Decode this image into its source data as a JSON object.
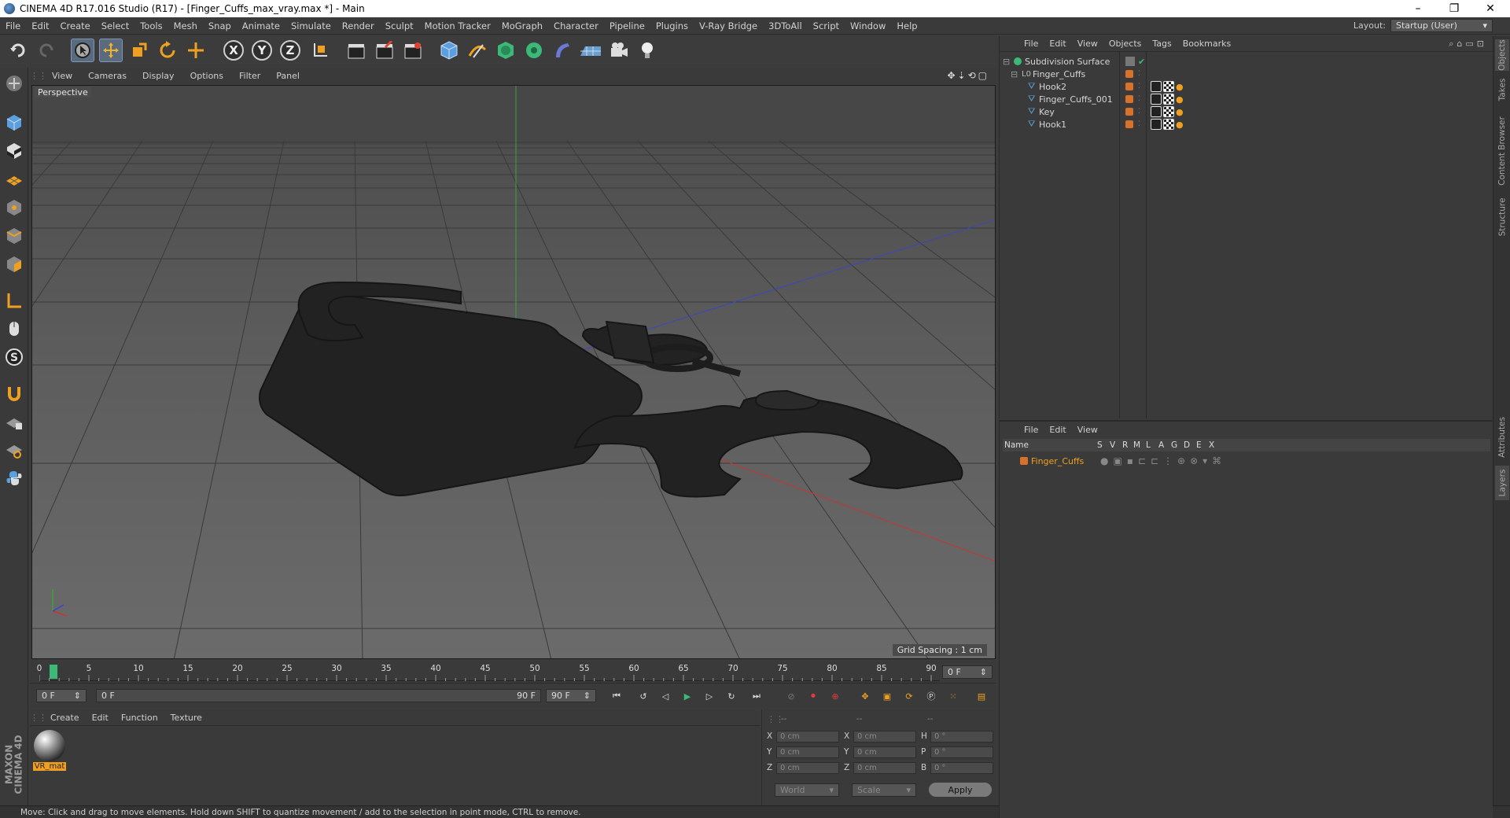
{
  "window": {
    "title": "CINEMA 4D R17.016 Studio (R17) - [Finger_Cuffs_max_vray.max *] - Main",
    "minimize": "–",
    "restore": "❐",
    "close": "✕"
  },
  "menu": [
    "File",
    "Edit",
    "Create",
    "Select",
    "Tools",
    "Mesh",
    "Snap",
    "Animate",
    "Simulate",
    "Render",
    "Sculpt",
    "Motion Tracker",
    "MoGraph",
    "Character",
    "Pipeline",
    "Plugins",
    "V-Ray Bridge",
    "3DToAll",
    "Script",
    "Window",
    "Help"
  ],
  "layout": {
    "label": "Layout:",
    "value": "Startup (User)"
  },
  "toolbar": {
    "axis_x": "X",
    "axis_y": "Y",
    "axis_z": "Z"
  },
  "viewport": {
    "menu": [
      "View",
      "Cameras",
      "Display",
      "Options",
      "Filter",
      "Panel"
    ],
    "label": "Perspective",
    "grid_spacing": "Grid Spacing : 1 cm"
  },
  "timeline": {
    "ticks": [
      "0",
      "5",
      "10",
      "15",
      "20",
      "25",
      "30",
      "35",
      "40",
      "45",
      "50",
      "55",
      "60",
      "65",
      "70",
      "75",
      "80",
      "85",
      "90"
    ],
    "current_frame": "0 F",
    "start": "0 F",
    "range_start": "0 F",
    "range_end": "90 F",
    "end": "90 F"
  },
  "material_manager": {
    "menu": [
      "Create",
      "Edit",
      "Function",
      "Texture"
    ],
    "material_name": "VR_mat"
  },
  "coordinates": {
    "header": [
      "--",
      "--",
      "--"
    ],
    "pos_labels": [
      "X",
      "Y",
      "Z"
    ],
    "pos_values": [
      "0 cm",
      "0 cm",
      "0 cm"
    ],
    "size_labels": [
      "X",
      "Y",
      "Z"
    ],
    "size_values": [
      "0 cm",
      "0 cm",
      "0 cm"
    ],
    "rot_labels": [
      "H",
      "P",
      "B"
    ],
    "rot_values": [
      "0 °",
      "0 °",
      "0 °"
    ],
    "mode": "World",
    "scale": "Scale",
    "apply": "Apply"
  },
  "objects": {
    "menu": [
      "File",
      "Edit",
      "View",
      "Objects",
      "Tags",
      "Bookmarks"
    ],
    "items": [
      {
        "name": "Subdivision Surface"
      },
      {
        "name": "Finger_Cuffs"
      },
      {
        "name": "Hook2"
      },
      {
        "name": "Finger_Cuffs_001"
      },
      {
        "name": "Key"
      },
      {
        "name": "Hook1"
      }
    ]
  },
  "layers": {
    "menu": [
      "File",
      "Edit",
      "View"
    ],
    "columns": [
      "Name",
      "S",
      "V",
      "R",
      "M",
      "L",
      "A",
      "G",
      "D",
      "E",
      "X"
    ],
    "items": [
      {
        "name": "Finger_Cuffs"
      }
    ]
  },
  "side_tabs": [
    "Objects",
    "Takes",
    "Content Browser",
    "Structure",
    "Attributes",
    "Layers"
  ],
  "status": "Move: Click and drag to move elements. Hold down SHIFT to quantize movement / add to the selection in point mode, CTRL to remove.",
  "logo": {
    "line1": "MAXON",
    "line2": "CINEMA 4D"
  },
  "colors": {
    "accent": "#d8722b",
    "timeline_cursor": "#3cb878",
    "selection": "#5a6b80"
  }
}
